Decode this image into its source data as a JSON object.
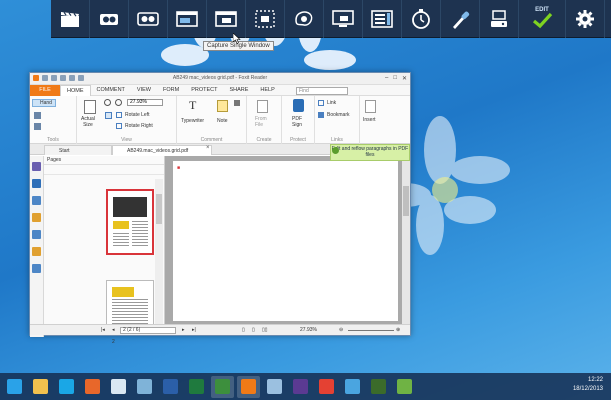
{
  "toolbar": {
    "tooltip": "Capture Single Window",
    "edit_label": "EDIT",
    "buttons": [
      {
        "name": "clapper-icon"
      },
      {
        "name": "camcorder-icon"
      },
      {
        "name": "dual-camcorder-icon"
      },
      {
        "name": "window-capture-icon"
      },
      {
        "name": "single-window-capture-icon"
      },
      {
        "name": "region-capture-icon"
      },
      {
        "name": "freehand-capture-icon"
      },
      {
        "name": "screen-capture-icon"
      },
      {
        "name": "scrolling-capture-icon"
      },
      {
        "name": "timer-icon"
      },
      {
        "name": "color-picker-icon"
      },
      {
        "name": "output-icon"
      },
      {
        "name": "edit-check-icon"
      },
      {
        "name": "settings-gear-icon"
      }
    ]
  },
  "reader": {
    "title": "AB249 mac_videos grid.pdf - Foxit Reader",
    "tabs": [
      "FILE",
      "HOME",
      "COMMENT",
      "VIEW",
      "FORM",
      "PROTECT",
      "SHARE",
      "HELP"
    ],
    "find_placeholder": "Find",
    "ribbon": {
      "hand": "Hand",
      "actual_size": "Actual\nSize",
      "zoom_value": "27.93%",
      "rotate_left": "Rotate Left",
      "rotate_right": "Rotate Right",
      "typewriter": "Typewriter",
      "note": "Note",
      "from_file": "From\nFile",
      "pdf_sign": "PDF\nSign",
      "link": "Link",
      "bookmark": "Bookmark",
      "insert": "Insert",
      "groups": [
        "Tools",
        "View",
        "Comment",
        "Create",
        "Protect",
        "Links"
      ]
    },
    "doc_tabs": {
      "start": "Start",
      "doc": "AB249.mac_videos.grid.pdf"
    },
    "promo": "Edit and reflow paragraphs in PDF files",
    "pages_label": "Pages",
    "thumb_page_number": "2",
    "status": {
      "page": "2 (2 / 6)",
      "zoom": "27.93%"
    }
  },
  "taskbar": {
    "apps": [
      {
        "name": "internet-explorer-icon",
        "color": "#2aa2e8"
      },
      {
        "name": "file-explorer-icon",
        "color": "#f2c14e"
      },
      {
        "name": "skype-icon",
        "color": "#1aa7e6"
      },
      {
        "name": "firefox-icon",
        "color": "#e8672a"
      },
      {
        "name": "notepad-icon",
        "color": "#d9e7f2"
      },
      {
        "name": "snipping-icon",
        "color": "#7fb3d8"
      },
      {
        "name": "word-icon",
        "color": "#2b5fa8"
      },
      {
        "name": "excel-icon",
        "color": "#1f7a3e"
      },
      {
        "name": "capture-app-icon",
        "color": "#3d8f3d"
      },
      {
        "name": "foxit-reader-icon",
        "color": "#f07a17"
      },
      {
        "name": "paint-icon",
        "color": "#9bc0e0"
      },
      {
        "name": "visual-studio-icon",
        "color": "#5b3a92"
      },
      {
        "name": "chrome-icon",
        "color": "#e44133"
      },
      {
        "name": "media-icon",
        "color": "#4aa5e0"
      },
      {
        "name": "game-icon",
        "color": "#3b6b2a"
      },
      {
        "name": "photo-icon",
        "color": "#6fb344"
      }
    ],
    "time": "12:22",
    "date": "18/12/2013"
  }
}
